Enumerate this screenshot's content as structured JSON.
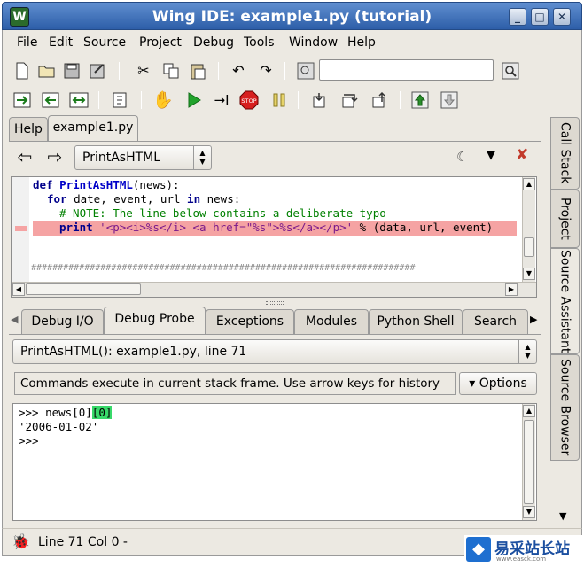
{
  "window": {
    "title": "Wing IDE: example1.py (tutorial)",
    "buttons": [
      "_",
      "□",
      "✕"
    ]
  },
  "menu": [
    "File",
    "Edit",
    "Source",
    "Project",
    "Debug",
    "Tools",
    "Window",
    "Help"
  ],
  "editor_tabs": [
    "Help",
    "example1.py"
  ],
  "scope_selector": {
    "value": "PrintAsHTML"
  },
  "code": {
    "line1_def": "def ",
    "line1_name": "PrintAsHTML",
    "line1_rest": "(news):",
    "line2_for": "for",
    "line2_mid": " date, event, url ",
    "line2_in": "in",
    "line2_rest": " news:",
    "line3_comment": "# NOTE: The line below contains a deliberate typo",
    "line4_print": "print",
    "line4_string": "'<p><i>%s</i> <a href=\"%s\">%s</a></p>'",
    "line4_rest": " % (data, url, event)",
    "hash_line": "########################################################################"
  },
  "bottom_tabs": [
    "Debug I/O",
    "Debug Probe",
    "Exceptions",
    "Modules",
    "Python Shell",
    "Search"
  ],
  "probe": {
    "frame_selector": "PrintAsHTML(): example1.py, line 71",
    "hint": "Commands execute in current stack frame.  Use arrow keys for history",
    "options_label": "▾ Options"
  },
  "shell": {
    "line1_prompt": ">>> news[0]",
    "line1_highlight": "[0]",
    "line2": "'2006-01-02'",
    "line3": ">>>"
  },
  "side_tabs": [
    "Call Stack",
    "Project",
    "Source Assistant",
    "Source Browser"
  ],
  "status": {
    "position": "Line 71 Col 0 -"
  },
  "watermark": {
    "main": "易采站长站",
    "sub": "www.easck.com"
  },
  "colors": {
    "error_line": "#f5a3a3",
    "title_bar": "#3f72bf",
    "match_highlight": "#38d96a"
  }
}
